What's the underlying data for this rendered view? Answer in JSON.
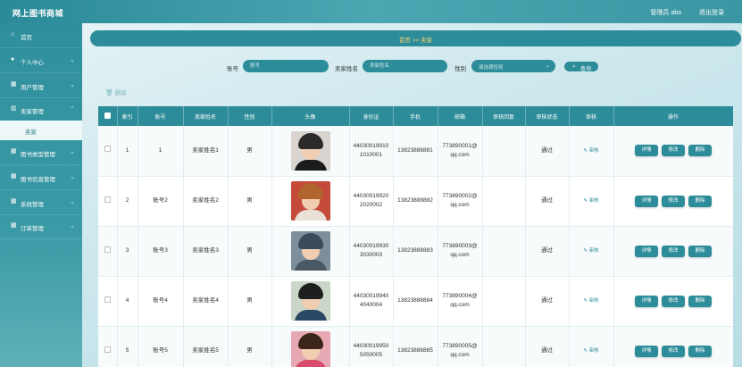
{
  "header": {
    "brand": "网上图书商城",
    "admin": "管理员 abo",
    "logout": "退出登录"
  },
  "sidebar": {
    "items": [
      {
        "label": "首页",
        "icon": "home-icon",
        "glyph": "⌂"
      },
      {
        "label": "个人中心",
        "icon": "user-icon",
        "glyph": "👤"
      },
      {
        "label": "用户管理",
        "icon": "grid-icon",
        "glyph": "▦"
      },
      {
        "label": "卖家管理",
        "icon": "chart-icon",
        "glyph": "▥"
      },
      {
        "label": "图书类型管理",
        "icon": "grid-icon",
        "glyph": "▦"
      },
      {
        "label": "图书信息管理",
        "icon": "grid-icon",
        "glyph": "▦"
      },
      {
        "label": "系统管理",
        "icon": "grid-icon",
        "glyph": "▦"
      },
      {
        "label": "订单管理",
        "icon": "grid-icon",
        "glyph": "▦"
      }
    ],
    "active_sub": "卖家"
  },
  "breadcrumb": {
    "text": "首页 >> 卖家"
  },
  "search": {
    "account_label": "账号",
    "account_placeholder": "账号",
    "name_label": "卖家姓名",
    "name_placeholder": "卖家姓名",
    "gender_label": "性别",
    "gender_value": "请选择性别",
    "query_label": "查询"
  },
  "toolbar": {
    "delete_label": "删除"
  },
  "table": {
    "headers": [
      "索引",
      "账号",
      "卖家姓名",
      "性别",
      "头像",
      "身份证",
      "手机",
      "邮箱",
      "审核回复",
      "审核状态",
      "审核",
      "操作"
    ],
    "rows": [
      {
        "index": "1",
        "account": "1",
        "name": "卖家姓名1",
        "gender": "男",
        "id1": "44030019910",
        "id2": "1010001",
        "phone": "13823888881",
        "email1": "773890001@",
        "email2": "qq.com",
        "reply": "",
        "status": "通过",
        "audit": "审核",
        "avatar": {
          "hair": "#2a2a2a",
          "bg": "#d9d4cf",
          "shirt": "#1b1b1b"
        }
      },
      {
        "index": "2",
        "account": "账号2",
        "name": "卖家姓名2",
        "gender": "男",
        "id1": "44030019920",
        "id2": "2020002",
        "phone": "13823888882",
        "email1": "773890002@",
        "email2": "qq.com",
        "reply": "",
        "status": "通过",
        "audit": "审核",
        "avatar": {
          "hair": "#b0652e",
          "bg": "#c44a3a",
          "shirt": "#e9e1d8"
        }
      },
      {
        "index": "3",
        "account": "账号3",
        "name": "卖家姓名3",
        "gender": "男",
        "id1": "44030019930",
        "id2": "3030003",
        "phone": "13823888883",
        "email1": "773890003@",
        "email2": "qq.com",
        "reply": "",
        "status": "通过",
        "audit": "审核",
        "avatar": {
          "hair": "#3a4a5a",
          "bg": "#7d8f9a",
          "shirt": "#4a5866"
        }
      },
      {
        "index": "4",
        "account": "账号4",
        "name": "卖家姓名4",
        "gender": "男",
        "id1": "44030019940",
        "id2": "4040004",
        "phone": "13823888884",
        "email1": "773890004@",
        "email2": "qq.com",
        "reply": "",
        "status": "通过",
        "audit": "审核",
        "avatar": {
          "hair": "#1e1e1e",
          "bg": "#c9d6c8",
          "shirt": "#2a4766"
        }
      },
      {
        "index": "5",
        "account": "账号5",
        "name": "卖家姓名5",
        "gender": "男",
        "id1": "44030019950",
        "id2": "5050005",
        "phone": "13823888885",
        "email1": "773890005@",
        "email2": "qq.com",
        "reply": "",
        "status": "通过",
        "audit": "审核",
        "avatar": {
          "hair": "#3b2418",
          "bg": "#e6a9b4",
          "shirt": "#d94b6a"
        }
      }
    ],
    "actions": {
      "detail": "详情",
      "edit": "修改",
      "delete": "删除"
    }
  }
}
